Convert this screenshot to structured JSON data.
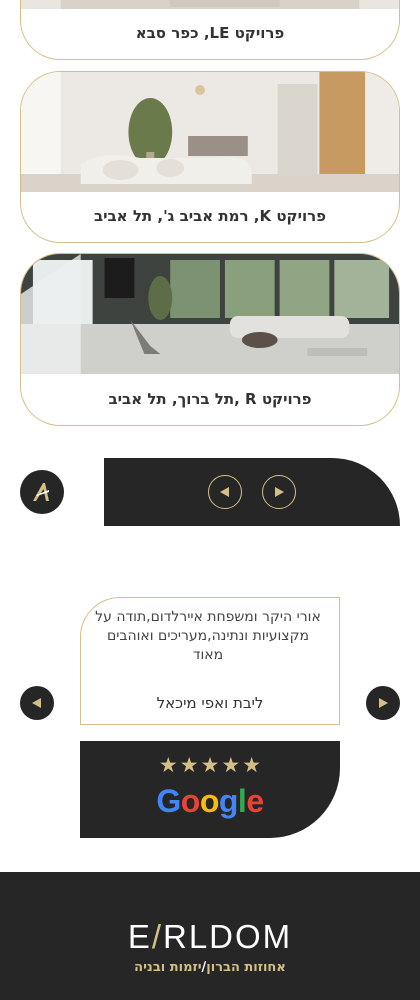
{
  "projects": [
    {
      "title": "פרויקט LE,  כפר סבא"
    },
    {
      "title": "פרויקט K,  רמת אביב ג', תל אביב"
    },
    {
      "title": "פרויקט R  ,תל ברוך, תל אביב"
    }
  ],
  "carousel": {
    "prev_icon": "arrow-left-icon",
    "next_icon": "arrow-right-icon"
  },
  "review": {
    "text": "אורי היקר ומשפחת איירלדום,תודה על מקצועיות ונתינה,מעריכים ואוהבים מאוד",
    "author": "ליבת ואפי מיכאל",
    "stars": "★★★★★",
    "rating": 5,
    "source": "Google"
  },
  "footer": {
    "brand": "EARLDOM",
    "tagline_left": "אחוזות הברון",
    "tagline_sep": "/",
    "tagline_right": "יזמות ובניה"
  },
  "colors": {
    "gold": "#d4bf86",
    "dark": "#262626",
    "google_blue": "#4285F4",
    "google_red": "#EA4335",
    "google_yellow": "#FBBC05",
    "google_green": "#34A853"
  }
}
